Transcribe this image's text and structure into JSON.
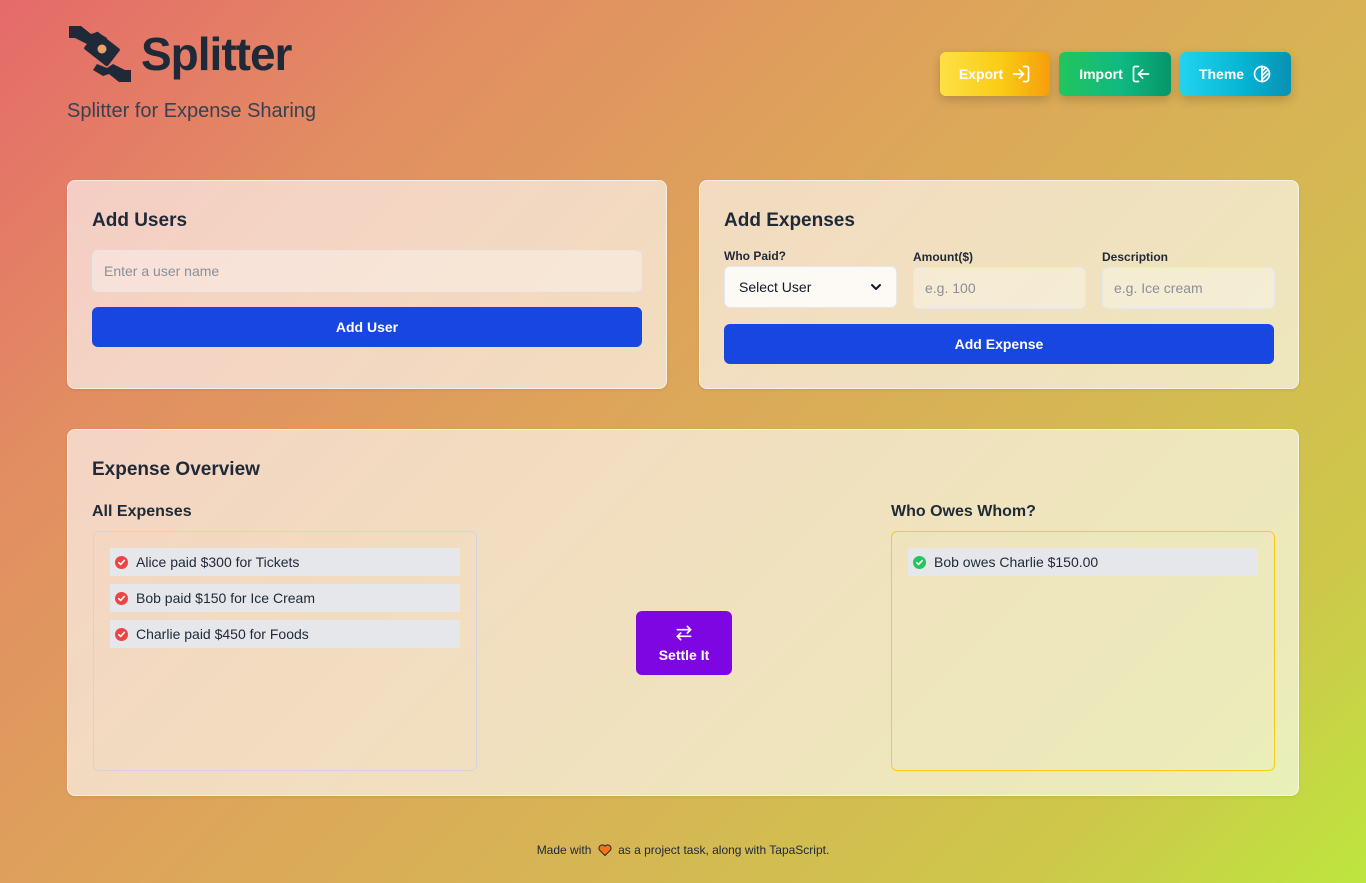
{
  "app": {
    "title": "Splitter",
    "subtitle": "Splitter for Expense Sharing"
  },
  "toolbar": {
    "export_label": "Export",
    "import_label": "Import",
    "theme_label": "Theme"
  },
  "add_users": {
    "heading": "Add Users",
    "input_placeholder": "Enter a user name",
    "input_value": "",
    "button_label": "Add User"
  },
  "add_expenses": {
    "heading": "Add Expenses",
    "who_paid_label": "Who Paid?",
    "who_paid_selected": "Select User",
    "amount_label": "Amount($)",
    "amount_placeholder": "e.g. 100",
    "description_label": "Description",
    "description_placeholder": "e.g. Ice cream",
    "button_label": "Add Expense"
  },
  "overview": {
    "heading": "Expense Overview",
    "all_expenses_heading": "All Expenses",
    "expenses": [
      {
        "text": "Alice paid $300 for Tickets"
      },
      {
        "text": "Bob paid $150 for Ice Cream"
      },
      {
        "text": "Charlie paid $450 for Foods"
      }
    ],
    "settle_label": "Settle It",
    "owes_heading": "Who Owes Whom?",
    "debts": [
      {
        "text": "Bob owes Charlie $150.00"
      }
    ]
  },
  "footer": {
    "before": "Made with",
    "after": "as a project task, along with TapaScript."
  },
  "colors": {
    "primary": "#1746e0",
    "settle": "#7e06e3",
    "expense_dot": "#ef4444",
    "debt_dot": "#22c55e",
    "owes_border": "#facc15"
  }
}
